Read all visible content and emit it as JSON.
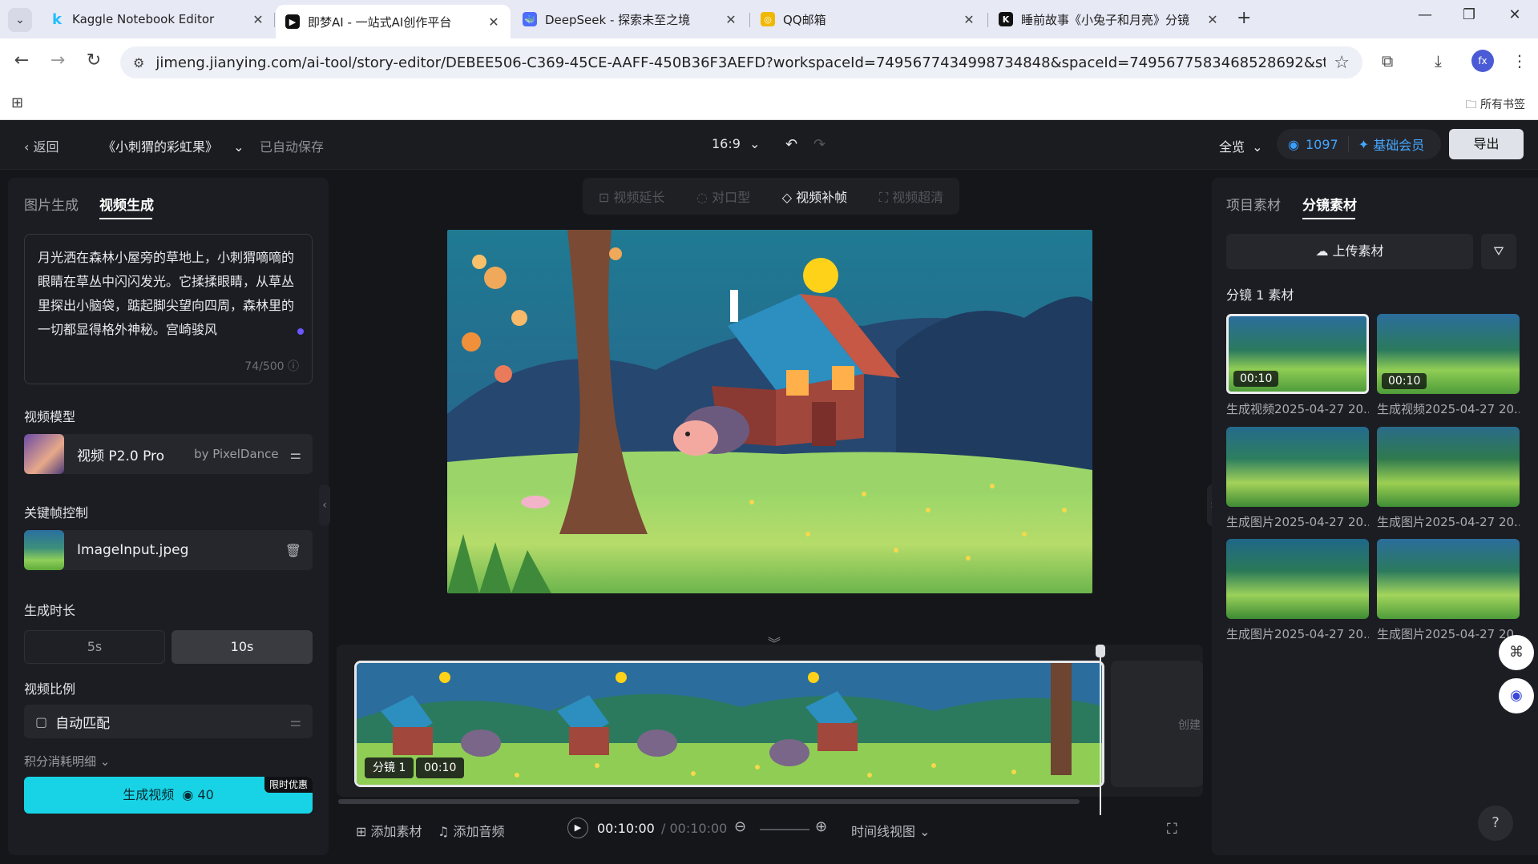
{
  "browser": {
    "tabs": [
      {
        "title": "Kaggle Notebook Editor",
        "close": "✕",
        "icon_letter": "k",
        "icon_color": "#20beff"
      },
      {
        "title": "即梦AI - 一站式AI创作平台",
        "close": "✕",
        "icon_letter": "▶",
        "icon_color": "#111111"
      },
      {
        "title": "DeepSeek - 探索未至之境",
        "close": "✕",
        "icon_letter": "🐳",
        "icon_color": "#4d6bfe"
      },
      {
        "title": "QQ邮箱",
        "close": "✕",
        "icon_letter": "◎",
        "icon_color": "#f0b800"
      },
      {
        "title": "睡前故事《小兔子和月亮》分镜",
        "close": "✕",
        "icon_letter": "K",
        "icon_color": "#111111"
      }
    ],
    "new_tab": "+",
    "window_controls": {
      "minimize": "—",
      "maximize": "❐",
      "close": "✕"
    },
    "url": "jimeng.jianying.com/ai-tool/story-editor/DEBEE506-C369-45CE-AAFF-450B36F3AEFD?workspaceId=7495677434998734848&spaceId=7495677583468528692&storyId=42...",
    "profile_initials": "fx",
    "bookmarks_label": "所有书签"
  },
  "topbar": {
    "back_label": "返回",
    "project_title": "《小刺猬的彩虹果》",
    "autosave_label": "已自动保存",
    "aspect_ratio": "16:9",
    "view_label": "全览",
    "credits": "1097",
    "membership": "基础会员",
    "export_label": "导出"
  },
  "left_panel": {
    "tabs": [
      "图片生成",
      "视频生成"
    ],
    "active_tab": "视频生成",
    "prompt": "月光洒在森林小屋旁的草地上，小刺猬嘀嘀的眼睛在草丛中闪闪发光。它揉揉眼睛，从草丛里探出小脑袋，踮起脚尖望向四周，森林里的一切都显得格外神秘。宫崎骏风",
    "prompt_count": "74/500",
    "model_section": "视频模型",
    "model_name": "视频 P2.0 Pro",
    "model_by": "by PixelDance",
    "keyframe_section": "关键帧控制",
    "keyframe_file": "ImageInput.jpeg",
    "duration_section": "生成时长",
    "durations": [
      "5s",
      "10s"
    ],
    "selected_duration": "10s",
    "ratio_section": "视频比例",
    "ratio_value": "自动匹配",
    "cost_detail": "积分消耗明细",
    "generate_label": "生成视频",
    "generate_cost": "40",
    "promo_badge": "限时优惠"
  },
  "center": {
    "tools": [
      {
        "label": "视频延长",
        "icon": "extend-icon",
        "active": false
      },
      {
        "label": "对口型",
        "icon": "lipsync-icon",
        "active": false
      },
      {
        "label": "视频补帧",
        "icon": "interpolate-icon",
        "active": true
      },
      {
        "label": "视频超清",
        "icon": "upscale-icon",
        "active": false
      }
    ],
    "timeline": {
      "clip_label": "分镜 1",
      "clip_duration": "00:10",
      "empty_slot_text": "创建"
    },
    "bottom": {
      "add_material": "添加素材",
      "add_audio": "添加音频",
      "current_time": "00:10:00",
      "total_time": "/ 00:10:00",
      "view_mode": "时间线视图"
    }
  },
  "right_panel": {
    "tabs": [
      "项目素材",
      "分镜素材"
    ],
    "active_tab": "分镜素材",
    "upload_label": "上传素材",
    "section_title": "分镜 1 素材",
    "assets": [
      {
        "caption": "生成视频2025-04-27 20...",
        "duration": "00:10"
      },
      {
        "caption": "生成视频2025-04-27 20...",
        "duration": "00:10"
      },
      {
        "caption": "生成图片2025-04-27 20...",
        "duration": ""
      },
      {
        "caption": "生成图片2025-04-27 20...",
        "duration": ""
      },
      {
        "caption": "生成图片2025-04-27 20...",
        "duration": ""
      },
      {
        "caption": "生成图片2025-04-27 20...",
        "duration": ""
      }
    ]
  },
  "colors": {
    "accent_cyan": "#18d3e6",
    "credit_blue": "#44a6ff",
    "app_bg": "#15161a"
  }
}
